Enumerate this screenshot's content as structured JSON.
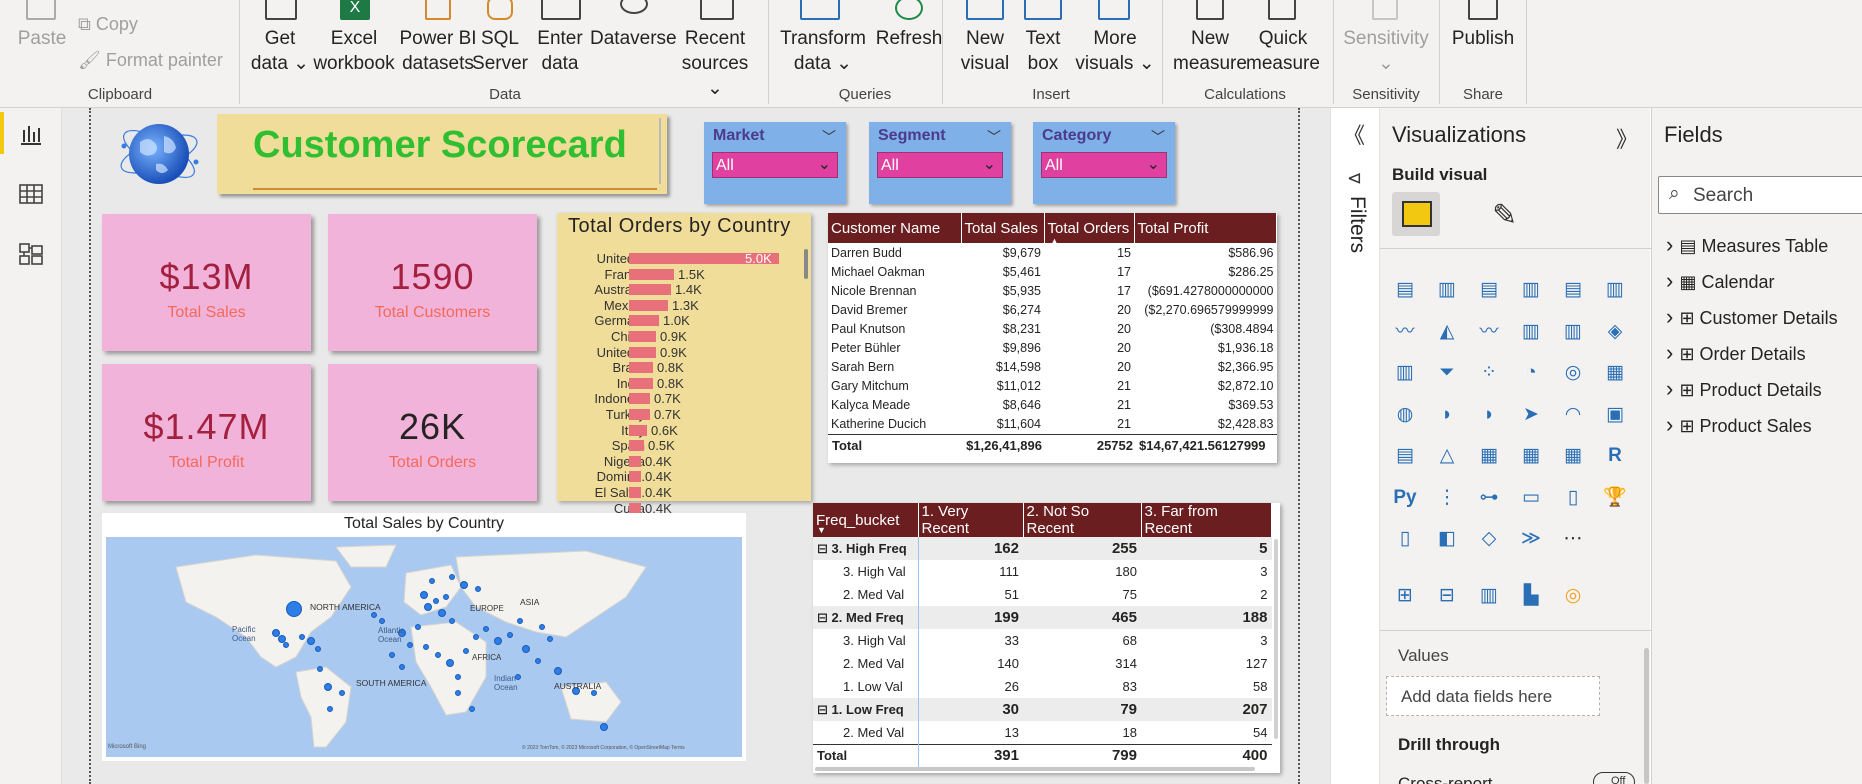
{
  "ribbon": {
    "clipboard": {
      "paste": "Paste",
      "copy": "Copy",
      "format_painter": "Format painter",
      "group": "Clipboard"
    },
    "data": {
      "get_data": "Get data",
      "excel": "Excel workbook",
      "power_bi": "Power BI datasets",
      "sql": "SQL Server",
      "enter": "Enter data",
      "dataverse": "Dataverse",
      "recent": "Recent sources",
      "group": "Data"
    },
    "queries": {
      "transform": "Transform data",
      "refresh": "Refresh",
      "group": "Queries"
    },
    "insert": {
      "new_visual": "New visual",
      "text_box": "Text box",
      "more_visuals": "More visuals",
      "group": "Insert"
    },
    "calculations": {
      "new_measure": "New measure",
      "quick_measure": "Quick measure",
      "group": "Calculations"
    },
    "sensitivity": {
      "label": "Sensitivity",
      "group": "Sensitivity"
    },
    "share": {
      "publish": "Publish",
      "group": "Share"
    }
  },
  "report": {
    "title": "Customer Scorecard",
    "slicers": [
      {
        "label": "Market",
        "value": "All"
      },
      {
        "label": "Segment",
        "value": "All"
      },
      {
        "label": "Category",
        "value": "All"
      }
    ],
    "cards": [
      {
        "value": "$13M",
        "label": "Total Sales"
      },
      {
        "value": "1590",
        "label": "Total Customers"
      },
      {
        "value": "$1.47M",
        "label": "Total  Profit"
      },
      {
        "value": "26K",
        "label": "Total Orders"
      }
    ],
    "map": {
      "title": "Total Sales by Country",
      "labels": {
        "na": "NORTH AMERICA",
        "sa": "SOUTH AMERICA",
        "eu": "EUROPE",
        "af": "AFRICA",
        "as": "ASIA",
        "au": "AUSTRALIA",
        "pac": "Pacific Ocean",
        "atl": "Atlantic Ocean",
        "ind": "Indian Ocean"
      },
      "attribution": "© 2023 TomTom, © 2023 Microsoft Corporation, © OpenStreetMap Terms",
      "brand": "Microsoft Bing"
    }
  },
  "chart_data": {
    "type": "bar",
    "title": "Total Orders by Country",
    "categories": [
      "United...",
      "France",
      "Australia",
      "Mexico",
      "Germa...",
      "China",
      "United...",
      "Brazil",
      "India",
      "Indone...",
      "Turkey",
      "Italy",
      "Spain",
      "Nigeria",
      "Domin...",
      "El Salv...",
      "Cuba"
    ],
    "values": [
      5.0,
      1.5,
      1.4,
      1.3,
      1.0,
      0.9,
      0.9,
      0.8,
      0.8,
      0.7,
      0.7,
      0.6,
      0.5,
      0.4,
      0.4,
      0.4,
      0.4
    ],
    "data_labels": [
      "5.0K",
      "1.5K",
      "1.4K",
      "1.3K",
      "1.0K",
      "0.9K",
      "0.9K",
      "0.8K",
      "0.8K",
      "0.7K",
      "0.7K",
      "0.6K",
      "0.5K",
      "0.4K",
      "0.4K",
      "0.4K",
      "0.4K"
    ],
    "orientation": "horizontal",
    "color": "#e8707a"
  },
  "customer_table": {
    "columns": [
      "Customer Name",
      "Total Sales",
      "Total Orders",
      "Total Profit"
    ],
    "rows": [
      [
        "Darren Budd",
        "$9,679",
        "15",
        "$586.96"
      ],
      [
        "Michael Oakman",
        "$5,461",
        "17",
        "$286.25"
      ],
      [
        "Nicole Brennan",
        "$5,935",
        "17",
        "($691.4278000000000"
      ],
      [
        "David Bremer",
        "$6,274",
        "20",
        "($2,270.696579999999"
      ],
      [
        "Paul Knutson",
        "$8,231",
        "20",
        "($308.4894"
      ],
      [
        "Peter Bühler",
        "$9,896",
        "20",
        "$1,936.18"
      ],
      [
        "Sarah Bern",
        "$14,598",
        "20",
        "$2,366.95"
      ],
      [
        "Gary Mitchum",
        "$11,012",
        "21",
        "$2,872.10"
      ],
      [
        "Kalyca Meade",
        "$8,646",
        "21",
        "$369.53"
      ],
      [
        "Katherine Ducich",
        "$11,604",
        "21",
        "$2,428.83"
      ]
    ],
    "total": [
      "Total",
      "$1,26,41,896",
      "25752",
      "$14,67,421.56127999"
    ]
  },
  "freq_table": {
    "columns": [
      "Freq_bucket",
      "1. Very Recent",
      "2. Not So Recent",
      "3. Far from Recent"
    ],
    "rows": [
      {
        "label": "3. High Freq",
        "vals": [
          "162",
          "255",
          "5"
        ],
        "level": 0
      },
      {
        "label": "3. High Val",
        "vals": [
          "111",
          "180",
          "3"
        ],
        "level": 1
      },
      {
        "label": "2. Med Val",
        "vals": [
          "51",
          "75",
          "2"
        ],
        "level": 1
      },
      {
        "label": "2. Med Freq",
        "vals": [
          "199",
          "465",
          "188"
        ],
        "level": 0
      },
      {
        "label": "3. High Val",
        "vals": [
          "33",
          "68",
          "3"
        ],
        "level": 1
      },
      {
        "label": "2. Med Val",
        "vals": [
          "140",
          "314",
          "127"
        ],
        "level": 1
      },
      {
        "label": "1. Low Val",
        "vals": [
          "26",
          "83",
          "58"
        ],
        "level": 1
      },
      {
        "label": "1. Low Freq",
        "vals": [
          "30",
          "79",
          "207"
        ],
        "level": 0
      },
      {
        "label": "2. Med Val",
        "vals": [
          "13",
          "18",
          "54"
        ],
        "level": 1
      }
    ],
    "total": [
      "Total",
      "391",
      "799",
      "400"
    ]
  },
  "filters": {
    "label": "Filters"
  },
  "visualizations": {
    "title": "Visualizations",
    "build_visual": "Build visual",
    "values_label": "Values",
    "add_fields": "Add data fields here",
    "drill_through": "Drill through",
    "cross_report": "Cross-report",
    "toggle": "Off"
  },
  "fields": {
    "title": "Fields",
    "search_placeholder": "Search",
    "items": [
      "Measures Table",
      "Calendar",
      "Customer Details",
      "Order Details",
      "Product Details",
      "Product Sales"
    ]
  }
}
